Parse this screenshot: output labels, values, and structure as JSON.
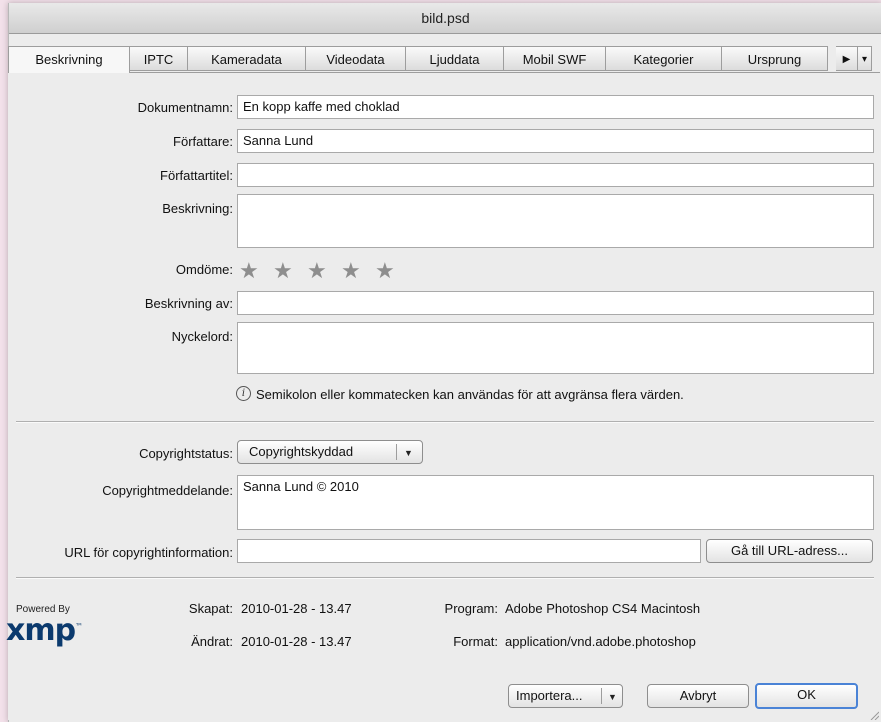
{
  "window": {
    "title": "bild.psd"
  },
  "tabs": [
    {
      "label": "Beskrivning",
      "active": true
    },
    {
      "label": "IPTC"
    },
    {
      "label": "Kameradata"
    },
    {
      "label": "Videodata"
    },
    {
      "label": "Ljuddata"
    },
    {
      "label": "Mobil SWF"
    },
    {
      "label": "Kategorier"
    },
    {
      "label": "Ursprung"
    }
  ],
  "tab_scroll": {
    "icon": "play-arrow-icon",
    "menu_icon": "menu-triangle-icon",
    "scroll_glyph": "▶",
    "menu_glyph": "▾"
  },
  "form": {
    "doc_name_label": "Dokumentnamn:",
    "doc_name_value": "En kopp kaffe med choklad",
    "author_label": "Författare:",
    "author_value": "Sanna Lund",
    "author_title_label": "Författartitel:",
    "author_title_value": "",
    "description_label": "Beskrivning:",
    "description_value": "",
    "rating_label": "Omdöme:",
    "rating_value": 0,
    "rating_max": 5,
    "star_glyph": "★",
    "description_writer_label": "Beskrivning av:",
    "description_writer_value": "",
    "keywords_label": "Nyckelord:",
    "keywords_value": "",
    "info_icon_glyph": "i",
    "hint": "Semikolon eller kommatecken kan användas för att avgränsa flera värden."
  },
  "copyright": {
    "status_label": "Copyrightstatus:",
    "status_value": "Copyrightskyddad",
    "dropdown_glyph": "▼",
    "notice_label": "Copyrightmeddelande:",
    "notice_value": "Sanna Lund © 2010",
    "url_label": "URL för copyrightinformation:",
    "url_value": "",
    "goto_url_button": "Gå till URL-adress..."
  },
  "meta": {
    "created_label": "Skapat:",
    "created_value": "2010-01-28 - 13.47",
    "modified_label": "Ändrat:",
    "modified_value": "2010-01-28 - 13.47",
    "program_label": "Program:",
    "program_value": "Adobe Photoshop CS4 Macintosh",
    "format_label": "Format:",
    "format_value": "application/vnd.adobe.photoshop"
  },
  "footer": {
    "powered_by": "Powered By",
    "logo_text": "xmp",
    "logo_tm": "™",
    "import_button": "Importera...",
    "cancel_button": "Avbryt",
    "ok_button": "OK"
  },
  "colors": {
    "accent": "#4a83d6",
    "logo": "#0b3a6e",
    "star": "#8e8e8e"
  }
}
